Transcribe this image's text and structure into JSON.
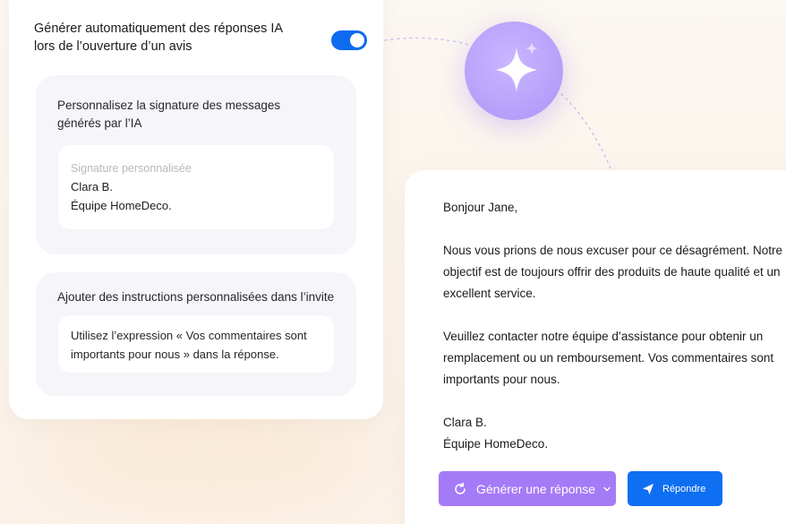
{
  "settings": {
    "auto_generate_label": "Générer automatiquement des réponses IA lors de l’ouverture d’un avis",
    "auto_generate_enabled": true,
    "signature": {
      "title": "Personnalisez la signature des messages générés par l’IA",
      "placeholder": "Signature personnalisée",
      "lines": [
        "Clara B.",
        "Équipe HomeDeco."
      ]
    },
    "instructions": {
      "title": "Ajouter des instructions personnalisées dans l’invite",
      "value": "Utilisez l’expression « Vos commentaires sont importants pour nous » dans la réponse."
    }
  },
  "reply": {
    "greeting": "Bonjour Jane,",
    "paragraph1": "Nous vous prions de nous excuser pour ce désagrément. Notre objectif est de toujours offrir des produits de haute qualité et un excellent service.",
    "paragraph2": "Veuillez contacter notre équipe d’assistance pour obtenir un remplacement ou un remboursement. Vos commentaires sont importants pour nous.",
    "signature_lines": [
      "Clara B.",
      "Équipe HomeDeco."
    ]
  },
  "actions": {
    "generate_label": "Générer une réponse",
    "reply_label": "Répondre"
  },
  "icons": {
    "orb": "sparkle-icon",
    "generate": "refresh-icon",
    "generate_menu": "chevron-down-icon",
    "reply": "send-icon"
  },
  "colors": {
    "toggle_on": "#0d6bf0",
    "generate_button": "#a57af7",
    "reply_button": "#0f6ff2",
    "orb": "#b9a4fb"
  }
}
